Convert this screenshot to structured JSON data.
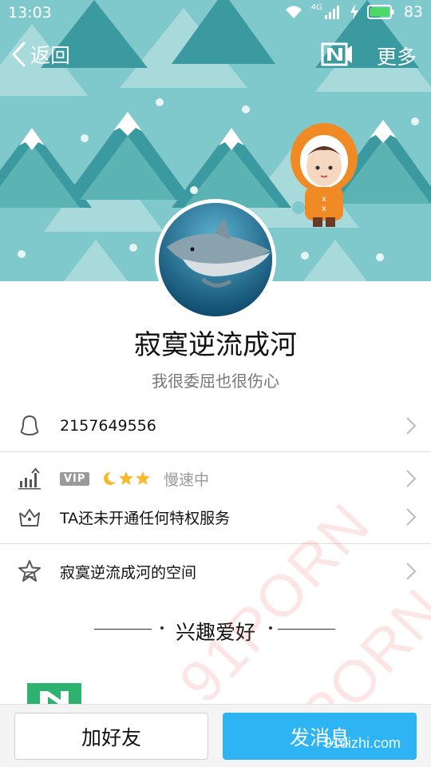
{
  "status_bar": {
    "time": "13:03",
    "network": "4G",
    "battery": "83"
  },
  "nav": {
    "back_label": "返回",
    "more_label": "更多"
  },
  "profile": {
    "name": "寂寞逆流成河",
    "signature": "我很委屈也很伤心"
  },
  "rows": {
    "qq_number": "2157649556",
    "vip_badge": "VIP",
    "speed_status": "慢速中",
    "privilege_text": "TA还未开通任何特权服务",
    "space_text": "寂寞逆流成河的空间"
  },
  "interests": {
    "title": "兴趣爱好"
  },
  "bottom": {
    "add_friend": "加好友",
    "send_message": "发消息"
  },
  "watermark": {
    "text": "91PORN",
    "site": "91dizhi.com"
  },
  "colors": {
    "accent_blue": "#2eb4f2",
    "cover_teal": "#7fc8cb",
    "tree_dark": "#3a9aa0",
    "tree_light": "#5bb3b4",
    "divider": "#dddddd"
  },
  "icons": {
    "status": [
      "wifi-icon",
      "signal-icon",
      "charging-icon",
      "battery-icon"
    ],
    "nav": [
      "back-chevron-icon",
      "switch-profile-icon"
    ],
    "rows": [
      "penguin-icon",
      "level-chart-icon",
      "crown-icon",
      "space-star-icon",
      "chevron-right-icon"
    ],
    "level": [
      "moon-icon",
      "star-icon",
      "star-icon"
    ]
  }
}
